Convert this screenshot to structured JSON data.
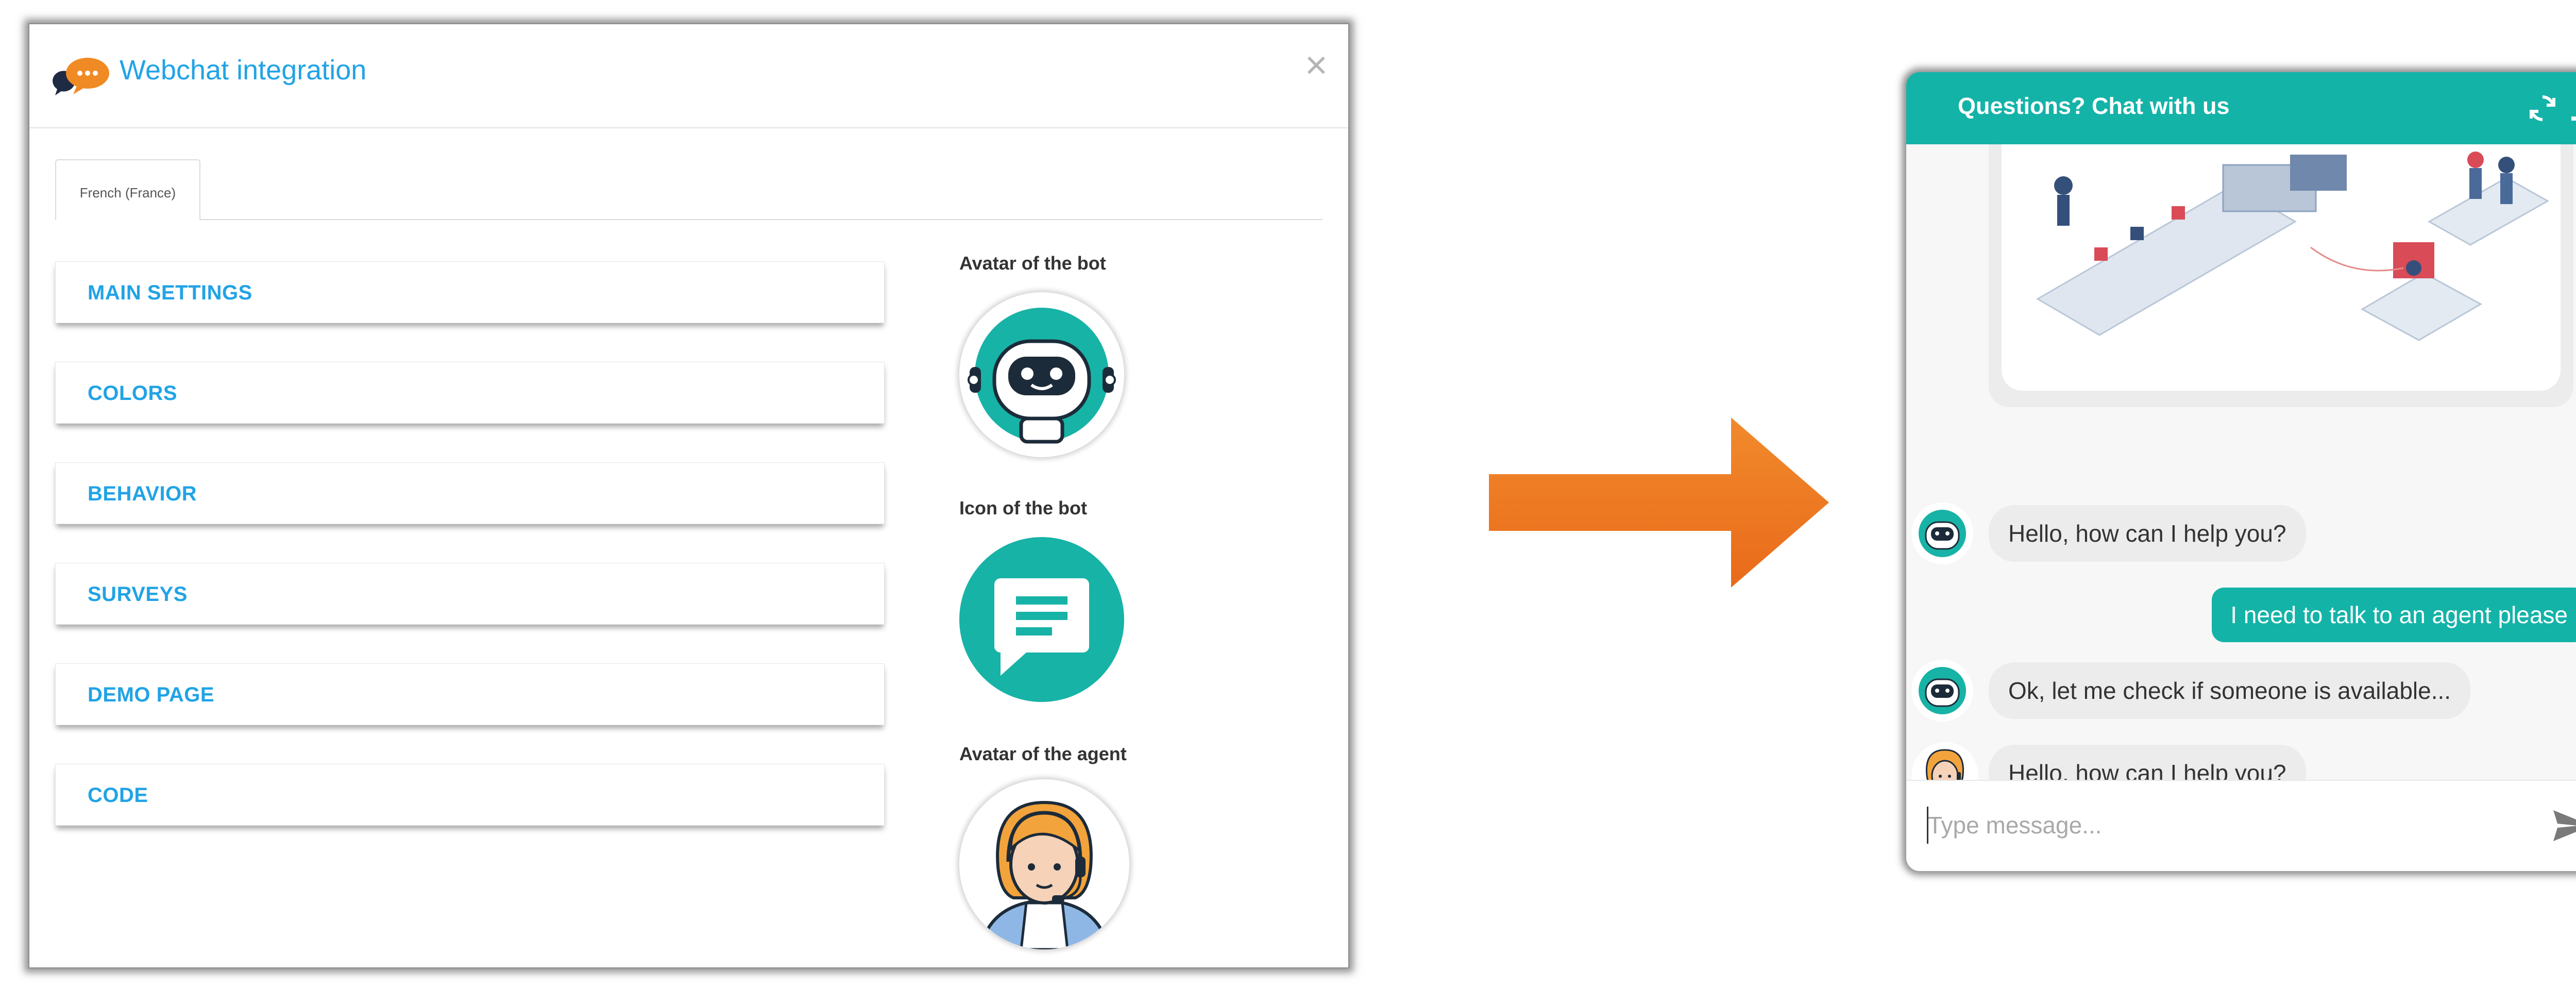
{
  "modal": {
    "title": "Webchat integration",
    "close_symbol": "×",
    "tab_label": "French (France)",
    "sections": [
      {
        "label": "MAIN SETTINGS"
      },
      {
        "label": "COLORS"
      },
      {
        "label": "BEHAVIOR"
      },
      {
        "label": "SURVEYS"
      },
      {
        "label": "DEMO PAGE"
      },
      {
        "label": "CODE"
      }
    ],
    "bot_avatar_label": "Avatar of the bot",
    "bot_icon_label": "Icon of the bot",
    "agent_avatar_label": "Avatar of the agent"
  },
  "chat": {
    "title": "Questions? Chat with us",
    "messages": [
      {
        "from": "bot",
        "text": "Hello, how can I help you?"
      },
      {
        "from": "user",
        "text": "I need to talk to an agent please"
      },
      {
        "from": "bot",
        "text": "Ok, let me check if someone is available..."
      },
      {
        "from": "agent",
        "text": "Hello, how can I help you?"
      }
    ],
    "input_placeholder": "Type message..."
  },
  "colors": {
    "accent_blue": "#21a3e6",
    "teal": "#14b3a8",
    "arrow_orange": "#ef7a22"
  },
  "icons": {
    "logo": "chat-bubbles-icon",
    "refresh": "refresh-icon",
    "minimize": "minimize-icon",
    "send": "send-icon"
  }
}
